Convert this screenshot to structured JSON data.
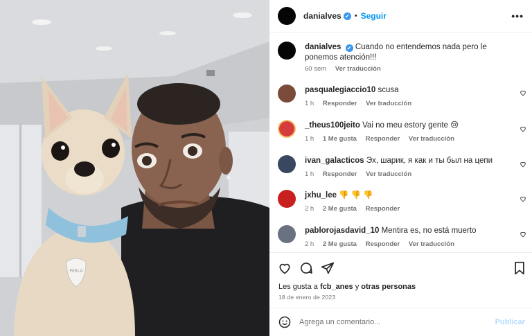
{
  "post": {
    "username": "danialves",
    "verified_mark": "✔",
    "separator": "•",
    "follow_label": "Seguir",
    "more_icon": "•••"
  },
  "caption": {
    "username": "danialves",
    "text": "Cuando no entendemos nada pero le ponemos atención!!!",
    "time": "60 sem",
    "translate": "Ver traducción"
  },
  "comments": [
    {
      "username": "pasqualegiaccio10",
      "text": "scusa",
      "time": "1 h",
      "likes": "",
      "reply": "Responder",
      "translate": "Ver traducción",
      "avatar_color": "#7a4a3a"
    },
    {
      "username": "_theus100jeito",
      "text": "Vai no meu estory gente 😢",
      "time": "1 h",
      "likes": "1 Me gusta",
      "reply": "Responder",
      "translate": "Ver traducción",
      "avatar_color": "#d63c3c"
    },
    {
      "username": "ivan_galacticos",
      "text": "Эх, шарик, я как и ты был на цепи",
      "time": "1 h",
      "likes": "",
      "reply": "Responder",
      "translate": "Ver traducción",
      "avatar_color": "#39475f"
    },
    {
      "username": "jxhu_lee",
      "text": "👎 👎 👎",
      "time": "2 h",
      "likes": "2 Me gusta",
      "reply": "Responder",
      "translate": "",
      "avatar_color": "#c8201f"
    },
    {
      "username": "pablorojasdavid_10",
      "text": "Mentira es, no está muerto",
      "time": "2 h",
      "likes": "2 Me gusta",
      "reply": "Responder",
      "translate": "Ver traducción",
      "avatar_color": "#6a7180"
    }
  ],
  "actions": {
    "icons": [
      "heart-icon",
      "comment-icon",
      "share-icon",
      "bookmark-icon"
    ],
    "likes_prefix": "Les gusta a",
    "likes_user": "fcb_anes",
    "likes_connector": "y",
    "likes_others": "otras personas",
    "date": "18 de enero de 2023"
  },
  "composer": {
    "placeholder": "Agrega un comentario...",
    "publish_label": "Publicar"
  },
  "photo": {
    "tag_text": "PERLA"
  }
}
